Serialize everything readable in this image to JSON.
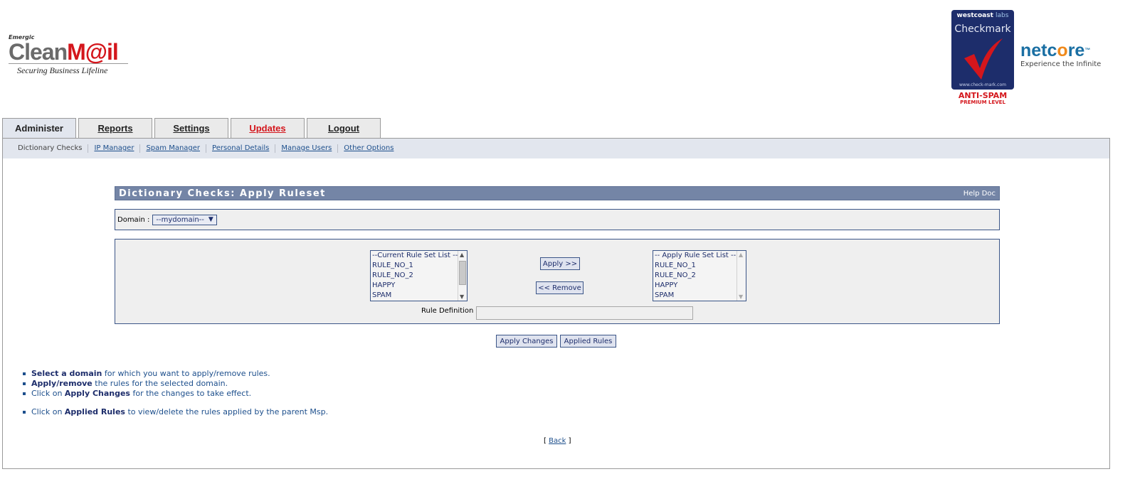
{
  "header": {
    "left_logo": {
      "small_text": "Emergic",
      "brand_part1": "Clean",
      "brand_part2": "M@il",
      "tagline": "Securing Business Lifeline"
    },
    "checkmark_badge": {
      "top_text": "westcoast",
      "top_labs": "labs",
      "title": "Checkmark",
      "url": "www.check-mark.com",
      "anti_spam": "ANTI-SPAM",
      "level": "PREMIUM LEVEL"
    },
    "right_logo": {
      "part1": "netc",
      "part2": "o",
      "part3": "re",
      "trademark": "™",
      "tagline": "Experience the Infinite"
    }
  },
  "tabs": [
    {
      "label": "Administer",
      "active": true
    },
    {
      "label": "Reports"
    },
    {
      "label": "Settings"
    },
    {
      "label": "Updates"
    },
    {
      "label": "Logout"
    }
  ],
  "subnav": [
    "Dictionary Checks",
    "IP Manager",
    "Spam Manager",
    "Personal Details",
    "Manage Users",
    "Other Options"
  ],
  "panel": {
    "title": "Dictionary Checks: Apply Ruleset",
    "help": "Help Doc"
  },
  "domain": {
    "label": "Domain :",
    "selected": "--mydomain--"
  },
  "current_list": {
    "options": [
      "--Current Rule Set List --",
      "RULE_NO_1",
      "RULE_NO_2",
      "HAPPY",
      "SPAM"
    ]
  },
  "apply_list": {
    "options": [
      "-- Apply Rule Set List --",
      "RULE_NO_1",
      "RULE_NO_2",
      "HAPPY",
      "SPAM"
    ]
  },
  "buttons": {
    "apply": "Apply >>",
    "remove": "<< Remove",
    "apply_changes": "Apply Changes",
    "applied_rules": "Applied Rules"
  },
  "rule_definition": {
    "label": "Rule Definition :",
    "value": ""
  },
  "instructions": [
    {
      "bold": "Select a domain",
      "rest": " for which you want to apply/remove rules."
    },
    {
      "bold": "Apply/remove",
      "rest": " the rules for the selected domain."
    },
    {
      "pre": "Click on ",
      "bold": "Apply Changes",
      "rest": " for the changes to take effect."
    },
    {
      "pre": "Click on ",
      "bold": "Applied Rules",
      "rest": " to view/delete the rules applied by the parent Msp."
    }
  ],
  "footer": {
    "open": "[",
    "back": "Back",
    "close": "]"
  },
  "colors": {
    "title_bar": "#7485a6",
    "link": "#1d4f8c",
    "updates_tab": "#d4161c",
    "border": "#3b5587"
  }
}
